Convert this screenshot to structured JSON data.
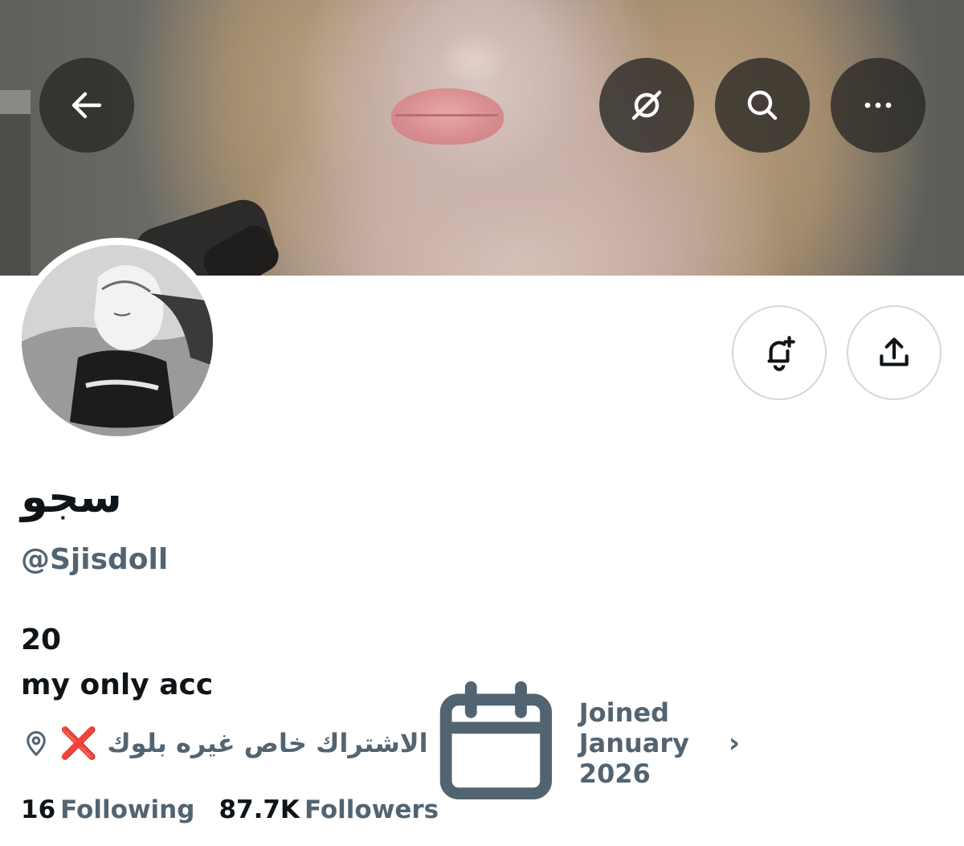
{
  "banner": {
    "icon": "profile-banner-photo"
  },
  "nav": {
    "back_icon": "arrow-left-icon",
    "grok_icon": "grok-slash-icon",
    "search_icon": "search-icon",
    "more_icon": "more-horizontal-icon"
  },
  "actions": {
    "notify_icon": "bell-plus-icon",
    "share_icon": "share-upload-icon"
  },
  "profile": {
    "display_name": "سجو",
    "handle": "@Sjisdoll",
    "bio_line1": "20",
    "bio_line2": "my only acc",
    "location": "الاشتراك خاص غيره بلوك",
    "location_emoji": "❌",
    "joined": "Joined January 2026",
    "joined_chevron": "›"
  },
  "stats": {
    "following_count": "16",
    "following_label": "Following",
    "followers_count": "87.7K",
    "followers_label": "Followers"
  },
  "colors": {
    "text_primary": "#0f1419",
    "text_secondary": "#536471",
    "border": "#cfd9de",
    "cross": "#e0242a"
  }
}
